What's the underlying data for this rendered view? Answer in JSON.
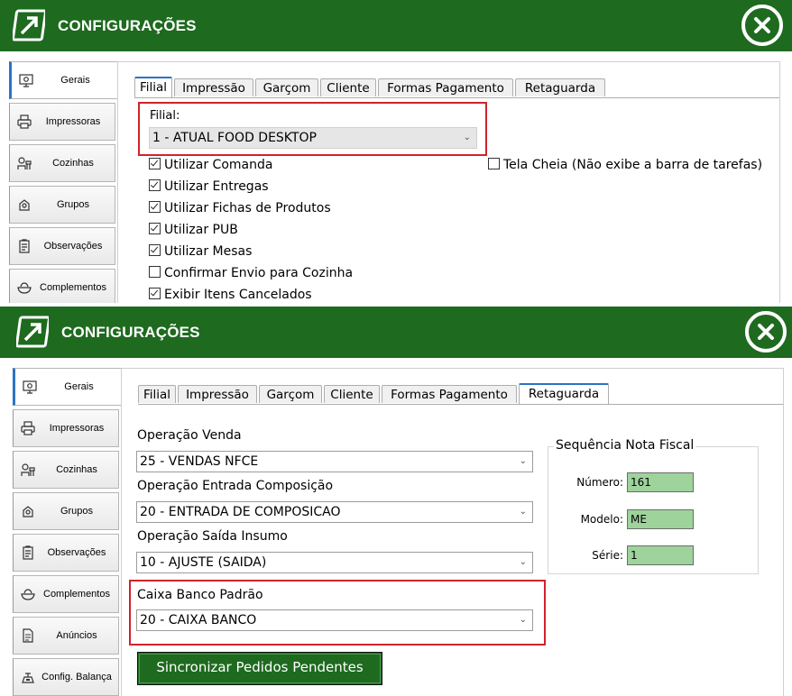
{
  "title": "CONFIGURAÇÕES",
  "sidebar_top": [
    {
      "label": "Gerais",
      "icon": "settings-screen-icon"
    },
    {
      "label": "Impressoras",
      "icon": "printer-icon"
    },
    {
      "label": "Cozinhas",
      "icon": "chef-icon"
    },
    {
      "label": "Grupos",
      "icon": "group-icon"
    },
    {
      "label": "Observações",
      "icon": "clipboard-icon"
    },
    {
      "label": "Complementos",
      "icon": "bowl-icon"
    }
  ],
  "sidebar_bottom": [
    {
      "label": "Gerais",
      "icon": "settings-screen-icon"
    },
    {
      "label": "Impressoras",
      "icon": "printer-icon"
    },
    {
      "label": "Cozinhas",
      "icon": "chef-icon"
    },
    {
      "label": "Grupos",
      "icon": "group-icon"
    },
    {
      "label": "Observações",
      "icon": "clipboard-icon"
    },
    {
      "label": "Complementos",
      "icon": "bowl-icon"
    },
    {
      "label": "Anúncios",
      "icon": "document-icon"
    },
    {
      "label": "Config. Balança",
      "icon": "scale-icon"
    }
  ],
  "tabs": [
    "Filial",
    "Impressão",
    "Garçom",
    "Cliente",
    "Formas Pagamento",
    "Retaguarda"
  ],
  "filial": {
    "label": "Filial:",
    "value": "1 - ATUAL FOOD DESKTOP",
    "checkboxes": [
      {
        "label": "Utilizar Comanda",
        "checked": true
      },
      {
        "label": "Utilizar Entregas",
        "checked": true
      },
      {
        "label": "Utilizar Fichas de Produtos",
        "checked": true
      },
      {
        "label": "Utilizar PUB",
        "checked": true
      },
      {
        "label": "Utilizar Mesas",
        "checked": true
      },
      {
        "label": "Confirmar Envio para Cozinha",
        "checked": false
      },
      {
        "label": "Exibir Itens Cancelados",
        "checked": true
      }
    ],
    "tela_cheia": {
      "label": "Tela Cheia (Não exibe a barra de tarefas)",
      "checked": false
    }
  },
  "retaguarda": {
    "operacao_venda": {
      "label": "Operação Venda",
      "value": "25 - VENDAS NFCE"
    },
    "operacao_entrada": {
      "label": "Operação Entrada Composição",
      "value": "20 - ENTRADA DE COMPOSICAO"
    },
    "operacao_saida": {
      "label": "Operação Saída Insumo",
      "value": "10 - AJUSTE (SAIDA)"
    },
    "caixa_banco": {
      "label": "Caixa Banco Padrão",
      "value": "20 - CAIXA BANCO"
    },
    "sequencia": {
      "title": "Sequência Nota Fiscal",
      "numero_label": "Número:",
      "numero": "161",
      "modelo_label": "Modelo:",
      "modelo": "ME",
      "serie_label": "Série:",
      "serie": "1"
    },
    "sync_button": "Sincronizar Pedidos Pendentes"
  },
  "colors": {
    "titlebar": "#1e6a1f",
    "accent": "#2a74c2",
    "highlight": "#d0232a",
    "field_green": "#9ed39c"
  }
}
